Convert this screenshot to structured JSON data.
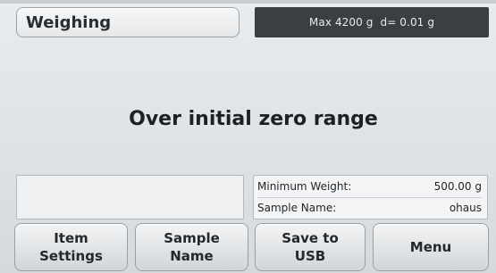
{
  "header": {
    "mode_title": "Weighing",
    "capacity": "Max 4200 g",
    "readability": "d= 0.01 g"
  },
  "main": {
    "message": "Over initial zero range"
  },
  "info": {
    "rows": [
      {
        "label": "Minimum Weight:",
        "value": "500.00 g"
      },
      {
        "label": "Sample Name:",
        "value": "ohaus"
      }
    ]
  },
  "buttons": {
    "item_settings": "Item\nSettings",
    "sample_name": "Sample\nName",
    "save_to_usb": "Save to\nUSB",
    "menu": "Menu"
  }
}
